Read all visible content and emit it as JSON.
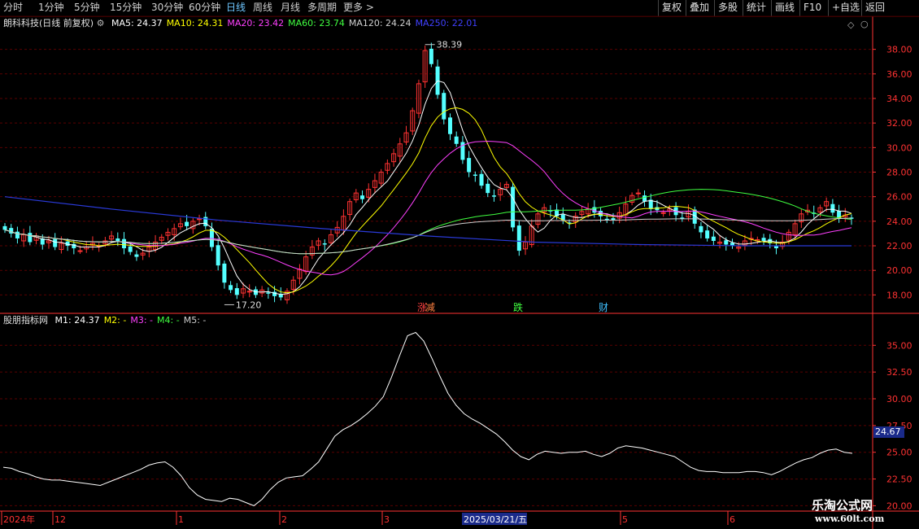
{
  "toolbar": {
    "left_tabs": [
      "分时",
      "1分钟",
      "5分钟",
      "15分钟",
      "30分钟",
      "60分钟",
      "日线",
      "周线",
      "月线",
      "多周期",
      "更多 >"
    ],
    "active_tab": "日线",
    "right_buttons": [
      "复权",
      "叠加",
      "多股",
      "统计",
      "画线",
      "F10",
      "+自选",
      "返回"
    ]
  },
  "main_legend": {
    "stock": "朗科科技(日线 前复权)",
    "ma": [
      {
        "label": "MA5:",
        "value": "24.37",
        "color": "#ffffff"
      },
      {
        "label": "MA10:",
        "value": "24.31",
        "color": "#ffff00"
      },
      {
        "label": "MA20:",
        "value": "23.42",
        "color": "#ff40ff"
      },
      {
        "label": "MA60:",
        "value": "23.74",
        "color": "#40ff40"
      },
      {
        "label": "MA120:",
        "value": "24.24",
        "color": "#d0d0d0"
      },
      {
        "label": "MA250:",
        "value": "22.01",
        "color": "#4040ff"
      }
    ]
  },
  "sub_legend": {
    "indicator": "股朋指标网",
    "items": [
      {
        "label": "M1:",
        "value": "24.37",
        "color": "#ffffff"
      },
      {
        "label": "M2:",
        "value": "-",
        "color": "#ffff00"
      },
      {
        "label": "M3:",
        "value": "-",
        "color": "#ff40ff"
      },
      {
        "label": "M4:",
        "value": "-",
        "color": "#40ff40"
      },
      {
        "label": "M5:",
        "value": "-",
        "color": "#d0d0d0"
      }
    ]
  },
  "annotations": {
    "high": "38.39",
    "low": "17.20",
    "events": [
      {
        "text": "涨",
        "color": "#ff4040"
      },
      {
        "text": "减",
        "color": "#ff8040"
      },
      {
        "text": "跌",
        "color": "#40ff40"
      },
      {
        "text": "财",
        "color": "#40c0ff"
      }
    ]
  },
  "x_axis": {
    "labels": [
      "2024年",
      "12",
      "1",
      "2",
      "3",
      "2025/03/21/五",
      "5",
      "6"
    ]
  },
  "current_value": "24.67",
  "watermark": {
    "line1": "乐淘公式网",
    "line2": "www.60lt.com"
  },
  "colors": {
    "up": "#ff3232",
    "down": "#54ffff",
    "grid": "#5a0000",
    "axis": "#ff3232",
    "ma250": "#2a3ad8"
  },
  "chart_data": [
    {
      "type": "candlestick",
      "ylim": [
        16.5,
        39.5
      ],
      "yticks": [
        18.0,
        20.0,
        22.0,
        24.0,
        26.0,
        28.0,
        30.0,
        32.0,
        34.0,
        36.0,
        38.0
      ],
      "closes": [
        23.3,
        23.0,
        22.6,
        22.9,
        22.3,
        22.8,
        22.1,
        22.4,
        21.9,
        22.2,
        22.0,
        21.8,
        21.6,
        21.9,
        22.2,
        22.0,
        22.4,
        22.8,
        22.4,
        21.8,
        21.5,
        21.1,
        21.4,
        21.9,
        22.3,
        22.7,
        23.1,
        23.4,
        23.8,
        23.6,
        24.0,
        24.2,
        23.6,
        21.9,
        20.4,
        19.0,
        18.4,
        18.0,
        18.5,
        18.3,
        18.0,
        18.4,
        18.1,
        17.9,
        17.8,
        18.3,
        19.2,
        20.1,
        21.1,
        21.9,
        22.4,
        22.1,
        22.9,
        23.5,
        24.4,
        25.6,
        26.3,
        25.8,
        26.6,
        27.3,
        28.0,
        28.7,
        29.5,
        30.3,
        31.2,
        33.0,
        35.2,
        37.9,
        36.8,
        34.3,
        32.3,
        31.1,
        30.3,
        29.0,
        28.0,
        27.7,
        26.9,
        26.3,
        26.0,
        26.6,
        27.0,
        23.5,
        21.6,
        22.3,
        23.6,
        24.6,
        25.1,
        24.8,
        24.4,
        24.1,
        23.8,
        24.4,
        24.8,
        25.0,
        24.7,
        24.4,
        24.1,
        24.1,
        24.7,
        25.4,
        26.1,
        26.3,
        25.6,
        25.0,
        24.9,
        24.7,
        25.0,
        24.5,
        24.2,
        24.8,
        23.8,
        23.1,
        22.6,
        22.4,
        22.3,
        22.1,
        22.0,
        21.9,
        22.4,
        22.6,
        22.5,
        22.4,
        22.2,
        21.8,
        22.3,
        23.1,
        23.8,
        24.6,
        24.9,
        24.6,
        25.1,
        25.6,
        24.7,
        24.2,
        24.5,
        24.2
      ],
      "ma_series": [
        "MA5",
        "MA10",
        "MA20",
        "MA60",
        "MA120",
        "MA250"
      ]
    },
    {
      "type": "line",
      "name": "M1",
      "ylim": [
        19.5,
        37.0
      ],
      "yticks": [
        20.0,
        22.5,
        25.0,
        27.5,
        30.0,
        32.5,
        35.0
      ],
      "values": [
        23.6,
        23.5,
        23.2,
        23.0,
        22.7,
        22.5,
        22.4,
        22.4,
        22.3,
        22.2,
        22.1,
        22.0,
        21.9,
        22.2,
        22.5,
        22.8,
        23.1,
        23.4,
        23.8,
        24.0,
        24.1,
        23.6,
        22.8,
        21.7,
        21.0,
        20.6,
        20.5,
        20.4,
        20.7,
        20.6,
        20.3,
        20.0,
        20.6,
        21.5,
        22.2,
        22.6,
        22.7,
        22.8,
        23.4,
        24.1,
        25.3,
        26.5,
        27.1,
        27.5,
        28.0,
        28.6,
        29.3,
        30.2,
        32.0,
        34.0,
        35.9,
        36.2,
        35.4,
        33.8,
        32.1,
        30.5,
        29.4,
        28.6,
        28.1,
        27.7,
        27.2,
        26.7,
        26.0,
        25.2,
        24.6,
        24.3,
        24.8,
        25.1,
        25.0,
        24.9,
        25.0,
        25.0,
        25.1,
        24.8,
        24.6,
        24.9,
        25.4,
        25.6,
        25.5,
        25.4,
        25.2,
        25.0,
        24.8,
        24.6,
        24.1,
        23.6,
        23.3,
        23.2,
        23.2,
        23.1,
        23.1,
        23.1,
        23.2,
        23.2,
        23.1,
        22.9,
        23.2,
        23.6,
        24.0,
        24.3,
        24.5,
        24.9,
        25.2,
        25.3,
        25.0,
        24.9
      ]
    }
  ]
}
